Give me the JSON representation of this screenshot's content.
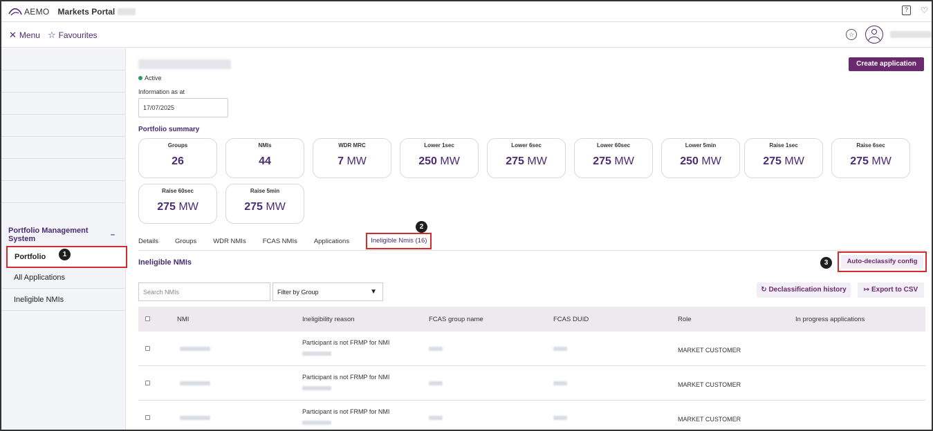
{
  "header": {
    "logo_text": "AEMO",
    "portal_title": "Markets Portal",
    "help_icon": "help-icon",
    "chat_icon": "chat-icon"
  },
  "menubar": {
    "menu_label": "Menu",
    "favourites_label": "Favourites"
  },
  "sidebar": {
    "section_title": "Portfolio Management System",
    "section_toggle": "–",
    "items": [
      {
        "label": "Portfolio",
        "active": true
      },
      {
        "label": "All Applications"
      },
      {
        "label": "Ineligible NMIs"
      }
    ]
  },
  "callouts": [
    "1",
    "2",
    "3"
  ],
  "main": {
    "status": "Active",
    "info_label": "Information as at",
    "info_date": "17/07/2025",
    "create_button": "Create application",
    "summary_title": "Portfolio summary",
    "cards": [
      {
        "label": "Groups",
        "value": "26",
        "unit": ""
      },
      {
        "label": "NMIs",
        "value": "44",
        "unit": ""
      },
      {
        "label": "WDR MRC",
        "value": "7",
        "unit": "MW"
      },
      {
        "label": "Lower 1sec",
        "value": "250",
        "unit": "MW"
      },
      {
        "label": "Lower 6sec",
        "value": "275",
        "unit": "MW"
      },
      {
        "label": "Lower 60sec",
        "value": "275",
        "unit": "MW"
      },
      {
        "label": "Lower 5min",
        "value": "250",
        "unit": "MW"
      },
      {
        "label": "Raise 1sec",
        "value": "275",
        "unit": "MW"
      },
      {
        "label": "Raise 6sec",
        "value": "275",
        "unit": "MW"
      },
      {
        "label": "Raise 60sec",
        "value": "275",
        "unit": "MW"
      },
      {
        "label": "Raise 5min",
        "value": "275",
        "unit": "MW"
      }
    ],
    "tabs": [
      "Details",
      "Groups",
      "WDR NMIs",
      "FCAS NMIs",
      "Applications",
      "Ineligible Nmis (16)"
    ],
    "active_tab": "Ineligible Nmis (16)",
    "section_title": "Ineligible NMIs",
    "auto_declassify": "Auto-declassify config",
    "search_placeholder": "Search NMIs",
    "filter_value": "Filter by Group",
    "declass_history": "Declassification history",
    "export_csv": "Export to CSV",
    "columns": [
      "NMI",
      "Ineligibility reason",
      "FCAS group name",
      "FCAS DUID",
      "Role",
      "In progress applications"
    ],
    "rows": [
      {
        "reason": "Participant is not FRMP for NMI",
        "role": "MARKET CUSTOMER"
      },
      {
        "reason": "Participant is not FRMP for NMI",
        "role": "MARKET CUSTOMER"
      },
      {
        "reason": "Participant is not FRMP for NMI",
        "role": "MARKET CUSTOMER"
      }
    ]
  },
  "colors": {
    "brand_purple": "#4b2b74",
    "button_purple": "#6b2a6e",
    "highlight_red": "#d42a2a",
    "active_green": "#2e9a5c"
  }
}
